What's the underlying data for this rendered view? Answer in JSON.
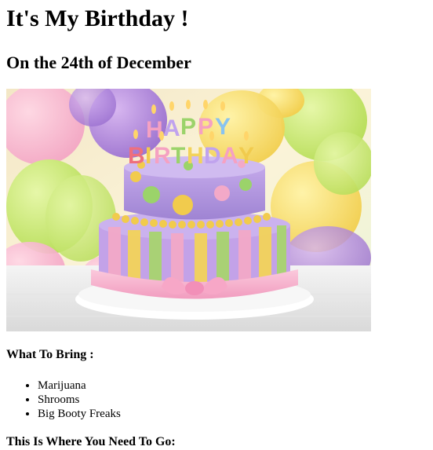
{
  "page": {
    "title": "It's My Birthday !",
    "subtitle": "On the 24th of December",
    "bring_heading": "What To Bring :",
    "bring_items": [
      "Marijuana",
      "Shrooms",
      "Big Booty Freaks"
    ],
    "go_heading": "This Is Where You Need To Go:",
    "cake_text": "HAPPY BIRTHDAY"
  },
  "colors": {
    "frosting_purple": "#b59ae0",
    "stripe_yellow": "#f3d35a",
    "stripe_green": "#a8d46f",
    "stripe_pink": "#f3a9c8",
    "ribbon_pink": "#f6b6cf",
    "dot_green": "#9bd36a",
    "dot_yellow": "#f1cb4d"
  }
}
